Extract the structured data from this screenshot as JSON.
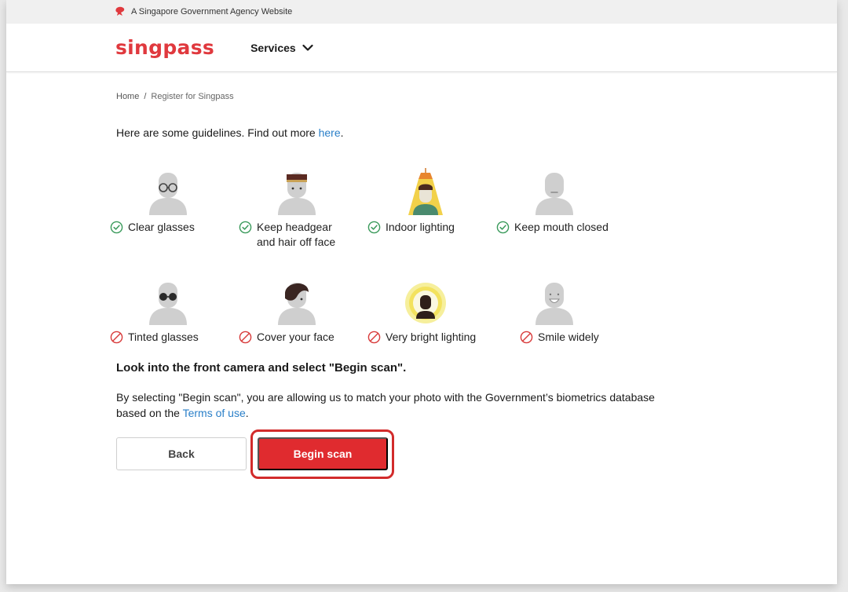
{
  "masthead": {
    "text": "A Singapore Government Agency Website"
  },
  "header": {
    "logo": "singpass",
    "services_label": "Services"
  },
  "breadcrumb": {
    "home": "Home",
    "separator": "/",
    "current": "Register for Singpass"
  },
  "intro": {
    "text": "Here are some guidelines. Find out more ",
    "link": "here",
    "suffix": "."
  },
  "guidelines_do": [
    {
      "label": "Clear glasses",
      "icon": "clear-glasses-figure"
    },
    {
      "label": "Keep headgear and hair off face",
      "icon": "headgear-figure"
    },
    {
      "label": "Indoor lighting",
      "icon": "indoor-lighting-figure"
    },
    {
      "label": "Keep mouth closed",
      "icon": "mouth-closed-figure"
    }
  ],
  "guidelines_dont": [
    {
      "label": "Tinted glasses",
      "icon": "tinted-glasses-figure"
    },
    {
      "label": "Cover your face",
      "icon": "covered-face-figure"
    },
    {
      "label": "Very bright lighting",
      "icon": "bright-lighting-figure"
    },
    {
      "label": "Smile widely",
      "icon": "smile-figure"
    }
  ],
  "instruction": "Look into the front camera and select \"Begin scan\".",
  "consent": {
    "text": "By selecting \"Begin scan\", you are allowing us to match your photo with the Government’s biometrics database based on the ",
    "link": "Terms of use",
    "suffix": "."
  },
  "buttons": {
    "back": "Back",
    "begin": "Begin scan"
  },
  "colors": {
    "brand_red": "#e0393e",
    "button_red": "#e02b2f",
    "ok_green": "#3a9a5b",
    "no_red": "#d83a3a",
    "link_blue": "#2a7fc8"
  }
}
